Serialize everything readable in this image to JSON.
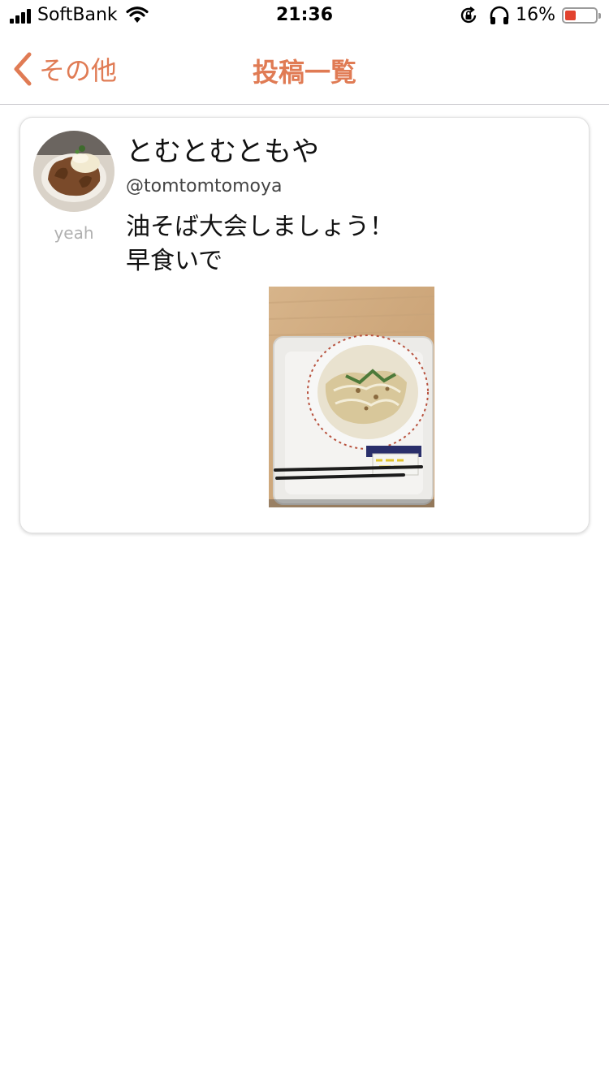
{
  "status_bar": {
    "carrier": "SoftBank",
    "time": "21:36",
    "battery_percent": "16%",
    "battery_level": 0.16,
    "signal_bars": 4,
    "icons": [
      "signal-icon",
      "wifi-icon",
      "rotation-lock-icon",
      "headphones-icon",
      "battery-icon"
    ]
  },
  "nav": {
    "back_label": "その他",
    "title": "投稿一覧",
    "accent_color": "#e07b54"
  },
  "posts": [
    {
      "display_name": "とむとむともや",
      "handle": "@tomtomtomoya",
      "avatar_caption": "yeah",
      "text": "油そば大会しましょう！\n早食いで",
      "image": "abura-soba-photo"
    }
  ]
}
